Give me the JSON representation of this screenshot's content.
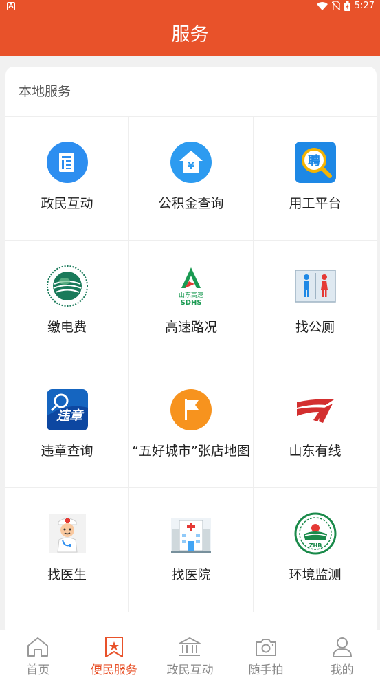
{
  "status": {
    "time": "5:27",
    "left_badge": "A"
  },
  "header": {
    "title": "服务"
  },
  "section": {
    "title": "本地服务"
  },
  "services": [
    {
      "label": "政民互动",
      "icon": "document-icon"
    },
    {
      "label": "公积金查询",
      "icon": "house-yen-icon"
    },
    {
      "label": "用工平台",
      "icon": "recruit-icon",
      "icon_text": "聘"
    },
    {
      "label": "缴电费",
      "icon": "state-grid-logo"
    },
    {
      "label": "高速路况",
      "icon": "sdhs-logo",
      "icon_text": "山东高速",
      "icon_text2": "SDHS"
    },
    {
      "label": "找公厕",
      "icon": "toilet-icon"
    },
    {
      "label": "违章查询",
      "icon": "violation-icon",
      "icon_text": "违章"
    },
    {
      "label": "“五好城市”张店地图",
      "icon": "flag-icon"
    },
    {
      "label": "山东有线",
      "icon": "shandong-cable-logo"
    },
    {
      "label": "找医生",
      "icon": "doctor-icon"
    },
    {
      "label": "找医院",
      "icon": "hospital-icon"
    },
    {
      "label": "环境监测",
      "icon": "environment-logo",
      "icon_text": "ZHB"
    }
  ],
  "tabs": [
    {
      "label": "首页",
      "icon": "home-icon",
      "active": false
    },
    {
      "label": "便民服务",
      "icon": "bookmark-star-icon",
      "active": true
    },
    {
      "label": "政民互动",
      "icon": "government-icon",
      "active": false
    },
    {
      "label": "随手拍",
      "icon": "camera-icon",
      "active": false
    },
    {
      "label": "我的",
      "icon": "user-icon",
      "active": false
    }
  ],
  "colors": {
    "accent": "#e8522a",
    "blue": "#2d8ef0",
    "orange": "#f7931e"
  }
}
